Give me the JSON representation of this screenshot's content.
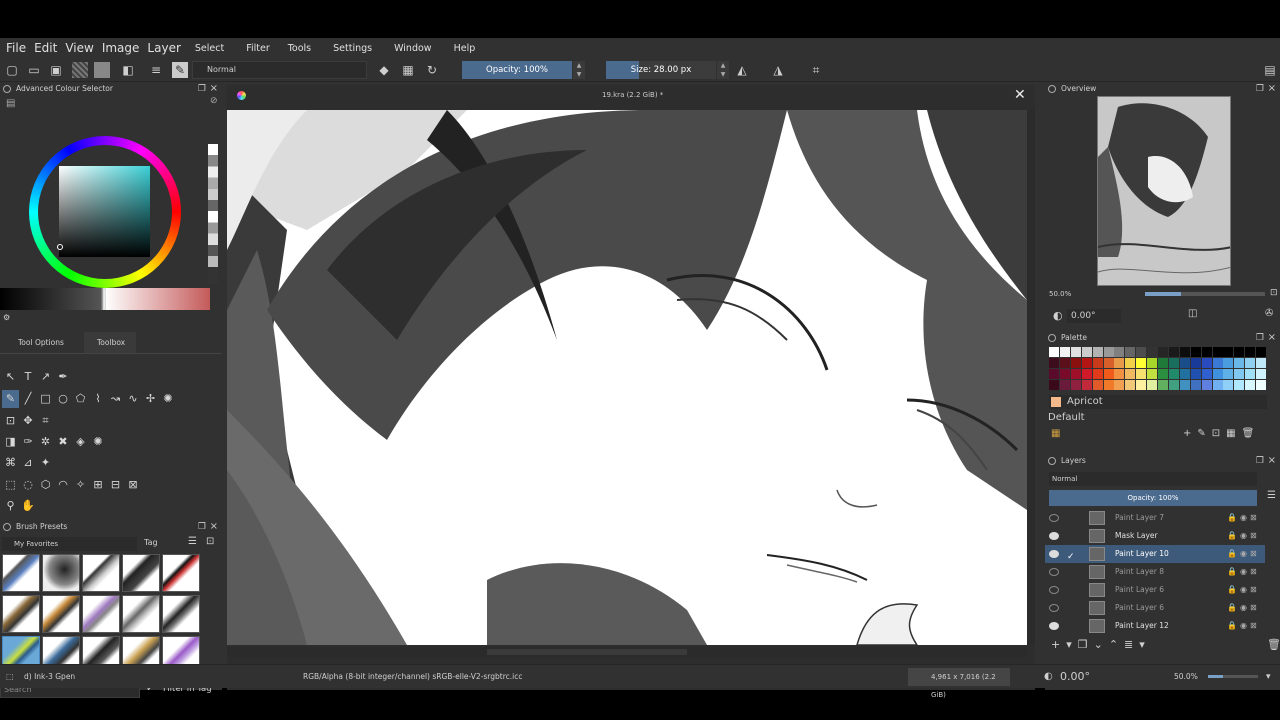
{
  "menu": [
    "File",
    "Edit",
    "View",
    "Image",
    "Layer",
    "Select",
    "Filter",
    "Tools",
    "Settings",
    "Window",
    "Help"
  ],
  "toolbar": {
    "blend_mode": "Normal",
    "opacity": "Opacity: 100%",
    "size": "Size: 28.00 px"
  },
  "colour_selector": {
    "title": "Advanced Colour Selector"
  },
  "tool_tabs": [
    "Tool Options",
    "Toolbox"
  ],
  "brush_presets": {
    "title": "Brush Presets",
    "tag_group": "My Favorites",
    "tag_label": "Tag",
    "search_placeholder": "Search",
    "filter_label": "Filter in Tag"
  },
  "document": {
    "title": "19.kra (2.2 GiB) *"
  },
  "overview": {
    "title": "Overview",
    "zoom": "50.0%",
    "rotation": "0.00°"
  },
  "palette": {
    "title": "Palette",
    "color_name": "Apricot",
    "palette_name": "Default",
    "swatches": [
      [
        "#ffffff",
        "#f2f2f2",
        "#e0e0e0",
        "#cccccc",
        "#b3b3b3",
        "#999999",
        "#808080",
        "#666666",
        "#4d4d4d",
        "#333333",
        "#262626",
        "#1a1a1a",
        "#0d0d0d",
        "#000000",
        "#000000",
        "#000000",
        "#000000",
        "#000000",
        "#000000",
        "#000000"
      ],
      [
        "#3d0d1e",
        "#5a0f1a",
        "#8a1010",
        "#b31515",
        "#c93a1a",
        "#d95f2a",
        "#e69a4a",
        "#f2d14a",
        "#ffff33",
        "#a6d62a",
        "#1f7a3a",
        "#1a6e5e",
        "#1a4e8a",
        "#1a3a9a",
        "#2a4ac0",
        "#3a7ad6",
        "#4a9ee0",
        "#6ab8e8",
        "#8fd0f0",
        "#bfe8f8"
      ],
      [
        "#5a0a2a",
        "#7a0a2a",
        "#a00f2a",
        "#d01a2a",
        "#e03a1a",
        "#f05a1a",
        "#f09040",
        "#f0b860",
        "#f5e070",
        "#c0e040",
        "#2a9040",
        "#208a6a",
        "#2070a0",
        "#2050b0",
        "#3060d0",
        "#4090e0",
        "#60b0e8",
        "#80c8f0",
        "#a0e0f8",
        "#d0f4ff"
      ],
      [
        "#3a0a1a",
        "#6a1a3a",
        "#902040",
        "#c02a3a",
        "#e05a2a",
        "#f07a2a",
        "#f0a050",
        "#f0c878",
        "#fff0a0",
        "#e0f0a0",
        "#60b060",
        "#40a080",
        "#4090c0",
        "#4070c0",
        "#6080e0",
        "#70b0f0",
        "#90d0f8",
        "#b0e8ff",
        "#d8f8ff",
        "#f0ffff"
      ]
    ]
  },
  "layers": {
    "title": "Layers",
    "blend_mode": "Normal",
    "opacity": "Opacity:  100%",
    "items": [
      {
        "name": "Paint Layer 7",
        "visible": false,
        "active": false
      },
      {
        "name": "Mask Layer",
        "visible": true,
        "active": false
      },
      {
        "name": "Paint Layer 10",
        "visible": true,
        "active": true
      },
      {
        "name": "Paint Layer 8",
        "visible": false,
        "active": false
      },
      {
        "name": "Paint Layer 6",
        "visible": false,
        "active": false
      },
      {
        "name": "Paint Layer 6",
        "visible": false,
        "active": false
      },
      {
        "name": "Paint Layer 12",
        "visible": true,
        "active": false
      }
    ]
  },
  "status": {
    "brush": "d) Ink-3 Gpen",
    "color_space": "RGB/Alpha (8-bit integer/channel)  sRGB-elle-V2-srgbtrc.icc",
    "image_size": "4,961 x 7,016 (2.2 GiB)",
    "rotation": "0.00°",
    "zoom": "50.0%"
  },
  "colors": {
    "accent": "#4a6a8e",
    "selection": "#3d5a7a",
    "bg": "#313131"
  }
}
